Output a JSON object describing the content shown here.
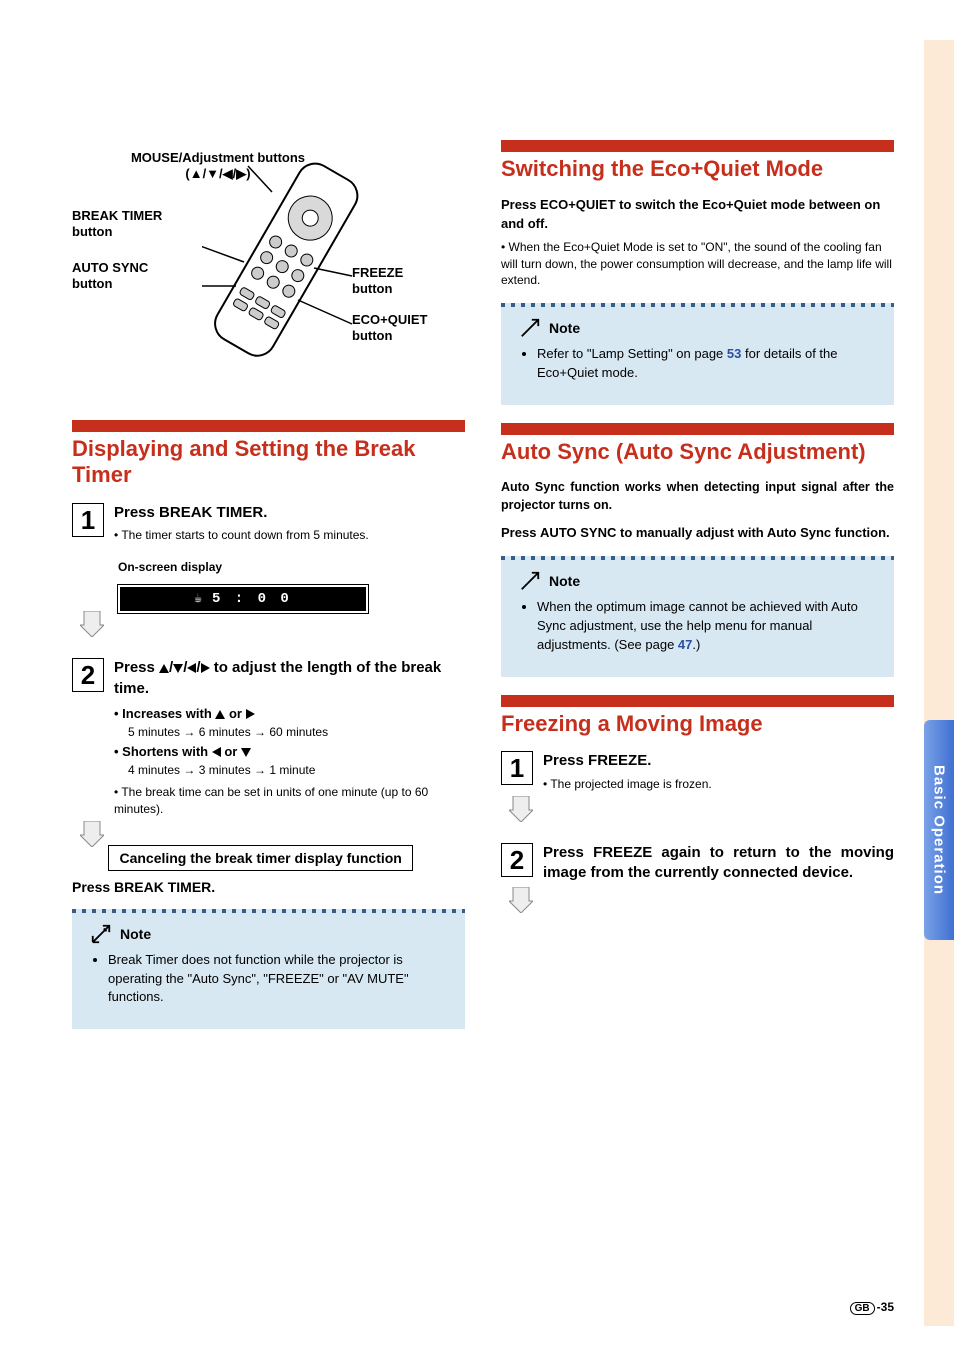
{
  "sideTab": "Basic Operation",
  "remote": {
    "mouse": "MOUSE/Adjustment buttons (▲/▼/◀/▶)",
    "breakTimer": "BREAK TIMER button",
    "autoSync": "AUTO SYNC button",
    "freeze": "FREEZE button",
    "ecoQuiet": "ECO+QUIET button"
  },
  "sections": {
    "breakTimer": {
      "title": "Displaying and Setting the Break Timer",
      "step1_pre": "Press ",
      "step1_btn": "BREAK TIMER",
      "step1_post": ".",
      "step1_note": "The timer starts to count down from 5 minutes.",
      "osdLabel": "On-screen display",
      "osdValue": "5 : 0 0",
      "step2_main": "Press ▲/▼/◀/▶ to adjust the length of the break time.",
      "inc_label": "Increases with ▲ or ▶",
      "inc_seq": "5 minutes → 6 minutes → 60 minutes",
      "dec_label": "Shortens with ◀ or ▼",
      "dec_seq": "4 minutes → 3 minutes → 1 minute",
      "cancelBox": "Canceling the break timer display function",
      "cancel_pre": "Press ",
      "cancel_btn": "BREAK TIMER",
      "cancel_post": ".",
      "cancelNote": "The break time can be set in units of one minute (up to 60 minutes).",
      "noteTitle": "Note",
      "noteItem": "Break Timer does not function while the projector is operating the \"Auto Sync\", \"FREEZE\" or \"AV MUTE\" functions."
    },
    "ecoQuiet": {
      "title": "Switching the Eco+Quiet Mode",
      "desc_pre": "Press ",
      "desc_btn": "ECO+QUIET",
      "desc_post": " to switch the Eco+Quiet mode between on and off.",
      "sub": "When the Eco+Quiet Mode is set to \"ON\", the sound of the cooling fan will turn down, the power consumption will decrease, and the lamp life will extend.",
      "noteTitle": "Note",
      "noteItem_pre": "Refer to \"Lamp Setting\" on page ",
      "noteLink": "53",
      "noteItem_post": " for details of the Eco+Quiet mode."
    },
    "autoSync": {
      "title": "Auto Sync (Auto Sync Adjustment)",
      "lead": "Auto Sync function works when detecting input signal after the projector turns on.",
      "desc_pre": "Press ",
      "desc_btn": "AUTO SYNC",
      "desc_post": " to manually adjust with Auto Sync function.",
      "noteTitle": "Note",
      "noteItem_pre": "When the optimum image cannot be achieved with Auto Sync adjustment, use the help menu for manual adjustments. (See page ",
      "noteLink": "47",
      "noteItem_post": ".)"
    },
    "freeze": {
      "title": "Freezing a Moving Image",
      "step1_pre": "Press ",
      "step1_btn": "FREEZE",
      "step1_post": ".",
      "step1_note": "The projected image is frozen.",
      "step2_pre": "Press ",
      "step2_btn": "FREEZE",
      "step2_post": " again to return to the moving image from the currently connected device."
    }
  },
  "pageNum": {
    "region": "GB",
    "num": "-35"
  }
}
